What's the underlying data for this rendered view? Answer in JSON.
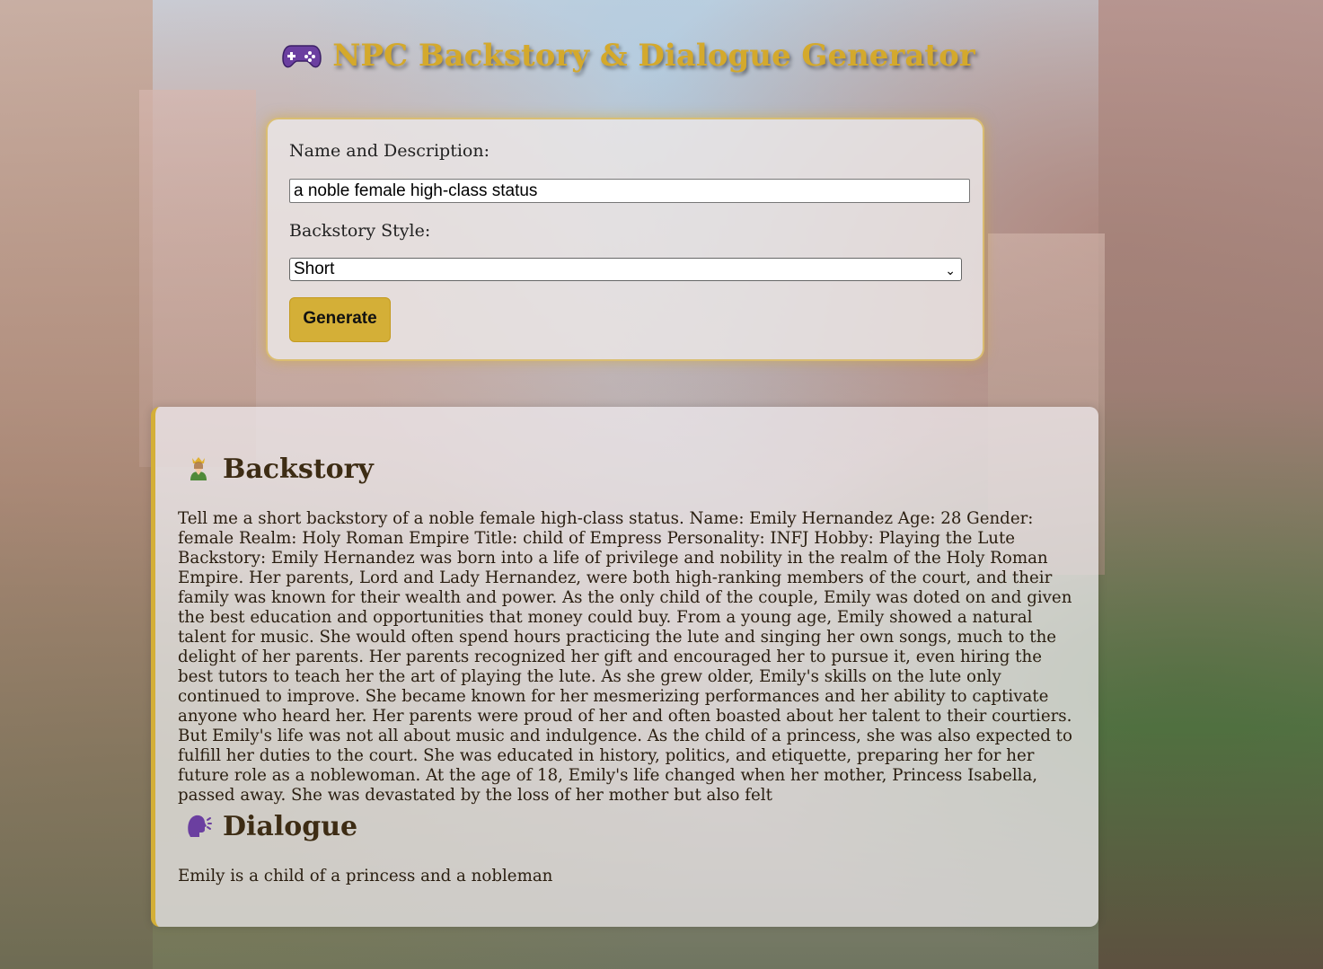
{
  "header": {
    "title": "NPC Backstory & Dialogue Generator",
    "icon": "gamepad-icon"
  },
  "form": {
    "name_label": "Name and Description:",
    "name_value": "a noble female high-class status",
    "style_label": "Backstory Style:",
    "style_selected": "Short",
    "generate_label": "Generate"
  },
  "output": {
    "backstory_heading": "Backstory",
    "backstory_icon": "person-icon",
    "backstory_text": "Tell me a short backstory of a noble female high-class status. Name: Emily Hernandez Age: 28 Gender: female Realm: Holy Roman Empire Title: child of Empress Personality: INFJ Hobby: Playing the Lute Backstory: Emily Hernandez was born into a life of privilege and nobility in the realm of the Holy Roman Empire. Her parents, Lord and Lady Hernandez, were both high-ranking members of the court, and their family was known for their wealth and power. As the only child of the couple, Emily was doted on and given the best education and opportunities that money could buy. From a young age, Emily showed a natural talent for music. She would often spend hours practicing the lute and singing her own songs, much to the delight of her parents. Her parents recognized her gift and encouraged her to pursue it, even hiring the best tutors to teach her the art of playing the lute. As she grew older, Emily's skills on the lute only continued to improve. She became known for her mesmerizing performances and her ability to captivate anyone who heard her. Her parents were proud of her and often boasted about her talent to their courtiers. But Emily's life was not all about music and indulgence. As the child of a princess, she was also expected to fulfill her duties to the court. She was educated in history, politics, and etiquette, preparing her for her future role as a noblewoman. At the age of 18, Emily's life changed when her mother, Princess Isabella, passed away. She was devastated by the loss of her mother but also felt",
    "dialogue_heading": "Dialogue",
    "dialogue_icon": "speaking-head-icon",
    "dialogue_text": "Emily is a child of a princess and a nobleman"
  },
  "colors": {
    "accent": "#d4af37",
    "title": "#d4a92c",
    "heading": "#3d2c14"
  }
}
